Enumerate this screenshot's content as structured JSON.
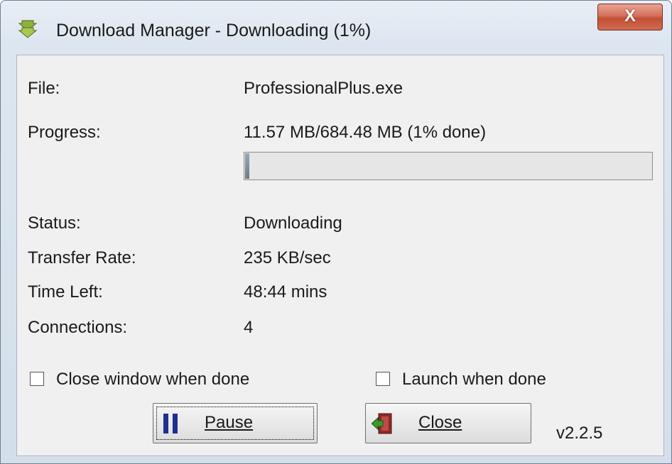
{
  "window": {
    "title": "Download Manager - Downloading (1%)",
    "close_glyph": "X"
  },
  "fields": {
    "file_label": "File:",
    "file_value": "ProfessionalPlus.exe",
    "progress_label": "Progress:",
    "progress_value": "11.57 MB/684.48 MB (1% done)",
    "progress_fraction": 0.01,
    "status_label": "Status:",
    "status_value": "Downloading",
    "rate_label": "Transfer Rate:",
    "rate_value": "235 KB/sec",
    "time_label": "Time Left:",
    "time_value": "48:44 mins",
    "conn_label": "Connections:",
    "conn_value": "4"
  },
  "options": {
    "close_when_done": "Close window when done",
    "launch_when_done": "Launch when done"
  },
  "buttons": {
    "pause": "Pause",
    "close": "Close"
  },
  "version": "v2.2.5",
  "colors": {
    "accent_green": "#7aa23a",
    "close_red": "#c24f36"
  }
}
